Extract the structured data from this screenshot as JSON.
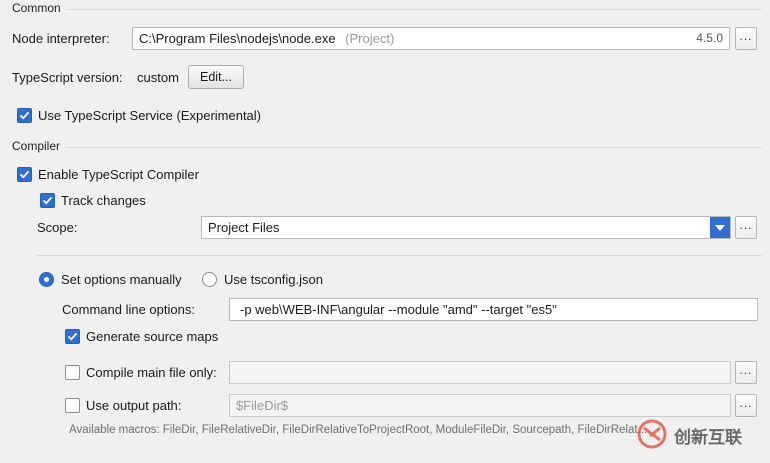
{
  "common": {
    "section_label": "Common",
    "node_interpreter_label": "Node interpreter:",
    "node_interpreter_value": "C:\\Program Files\\nodejs\\node.exe",
    "node_interpreter_tag": "(Project)",
    "node_version": "4.5.0",
    "browse_label": "...",
    "typescript_version_label": "TypeScript version:",
    "typescript_version_value": "custom",
    "edit_button_label": "Edit...",
    "use_service_label": "Use TypeScript Service (Experimental)",
    "use_service_checked": true
  },
  "compiler": {
    "section_label": "Compiler",
    "enable_compiler_label": "Enable TypeScript Compiler",
    "enable_compiler_checked": true,
    "track_changes_label": "Track changes",
    "track_changes_checked": true,
    "scope_label": "Scope:",
    "scope_value": "Project Files",
    "scope_browse_label": "...",
    "set_options_manually_label": "Set options manually",
    "use_tsconfig_label": "Use tsconfig.json",
    "selected_option": "manual",
    "command_line_label": "Command line options:",
    "command_line_value": "-p web\\WEB-INF\\angular --module \"amd\" --target \"es5\"",
    "generate_source_maps_label": "Generate source maps",
    "generate_source_maps_checked": true,
    "compile_main_file_label": "Compile main file only:",
    "compile_main_file_checked": false,
    "compile_main_file_value": "",
    "compile_browse_label": "...",
    "use_output_path_label": "Use output path:",
    "use_output_path_checked": false,
    "output_path_placeholder": "$FileDir$",
    "output_browse_label": "...",
    "available_macros": "Available macros: FileDir, FileRelativeDir, FileDirRelativeToProjectRoot, ModuleFileDir, Sourcepath, FileDirRelat..."
  },
  "watermark": {
    "text": "创新互联"
  },
  "colors": {
    "accent": "#2f6fd0",
    "background": "#f0f0f0",
    "muted_text": "#9a9a9a"
  }
}
